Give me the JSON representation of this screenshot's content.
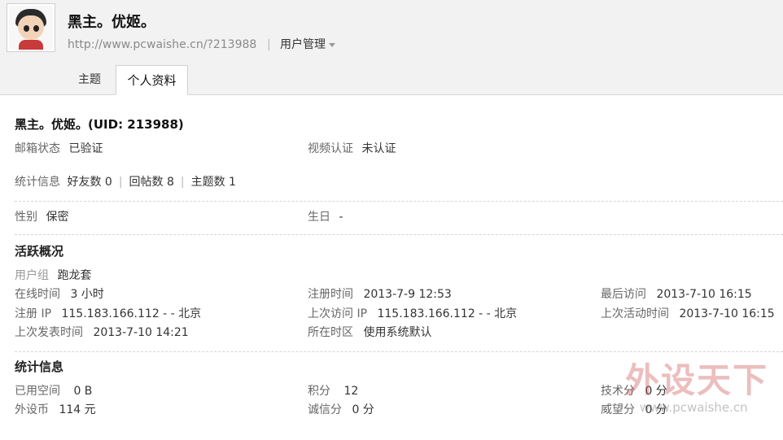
{
  "header": {
    "username": "黑主。优姬。",
    "url": "http://www.pcwaishe.cn/?213988",
    "user_manage": "用户管理",
    "tabs": [
      {
        "label": "主题"
      },
      {
        "label": "个人资料"
      }
    ]
  },
  "profile": {
    "name_line": "黑主。优姬。(UID: 213988)",
    "email_status_label": "邮箱状态",
    "email_status_value": "已验证",
    "video_auth_label": "视频认证",
    "video_auth_value": "未认证",
    "stats_label": "统计信息",
    "friends": "好友数 0",
    "replies": "回帖数 8",
    "topics": "主题数 1",
    "gender_label": "性别",
    "gender_value": "保密",
    "birthday_label": "生日",
    "birthday_value": "-"
  },
  "activity": {
    "title": "活跃概况",
    "user_group_label": "用户组",
    "user_group_value": "跑龙套",
    "online_time_label": "在线时间",
    "online_time_value": "3 小时",
    "register_time_label": "注册时间",
    "register_time_value": "2013-7-9 12:53",
    "last_visit_label": "最后访问",
    "last_visit_value": "2013-7-10 16:15",
    "register_ip_label": "注册 IP",
    "register_ip_value": "115.183.166.112 - - 北京",
    "last_visit_ip_label": "上次访问 IP",
    "last_visit_ip_value": "115.183.166.112 - - 北京",
    "last_active_label": "上次活动时间",
    "last_active_value": "2013-7-10 16:15",
    "last_post_label": "上次发表时间",
    "last_post_value": "2013-7-10 14:21",
    "timezone_label": "所在时区",
    "timezone_value": "使用系统默认"
  },
  "stats": {
    "title": "统计信息",
    "space_label": "已用空间",
    "space_value": "0 B",
    "points_label": "积分",
    "points_value": "12",
    "tech_label": "技术分",
    "tech_value": "0 分",
    "coins_label": "外设币",
    "coins_value": "114 元",
    "credit_label": "诚信分",
    "credit_value": "0 分",
    "prestige_label": "威望分",
    "prestige_value": "0 分"
  },
  "watermark": {
    "text_cn": "外设天下",
    "text_url": "www.pcwaishe.cn"
  }
}
